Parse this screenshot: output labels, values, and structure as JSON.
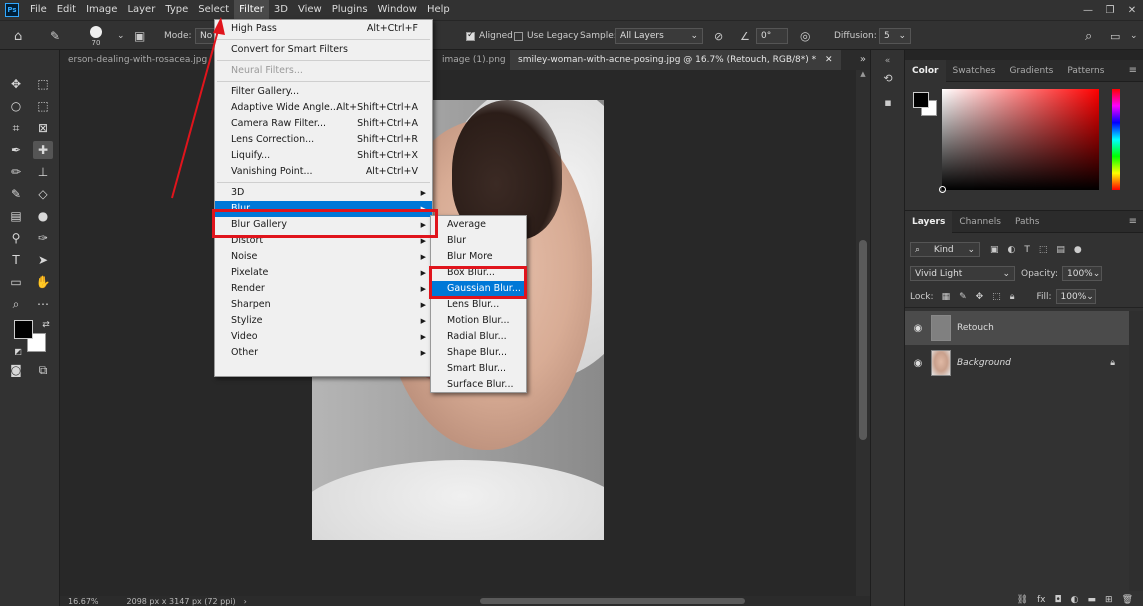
{
  "menubar": {
    "logo": "Ps",
    "items": [
      "File",
      "Edit",
      "Image",
      "Layer",
      "Type",
      "Select",
      "Filter",
      "3D",
      "View",
      "Plugins",
      "Window",
      "Help"
    ],
    "active": "Filter",
    "window_controls": [
      "—",
      "❐",
      "✕"
    ]
  },
  "options": {
    "brush_size": "70",
    "mode_label": "Mode:",
    "mode_value": "No",
    "aligned_label": "Aligned",
    "use_legacy_label": "Use Legacy",
    "sample_label": "Sample:",
    "sample_value": "All Layers",
    "angle_value": "0°",
    "diffusion_label": "Diffusion:",
    "diffusion_value": "5"
  },
  "tabs": [
    {
      "label": "erson-dealing-with-rosacea.jpg",
      "active": false
    },
    {
      "label": "image (1).png",
      "active": false
    },
    {
      "label": "smiley-woman-with-acne-posing.jpg @ 16.7% (Retouch, RGB/8*) *",
      "active": true
    }
  ],
  "status": {
    "zoom": "16.67%",
    "dimensions": "2098 px x 3147 px (72 ppi)"
  },
  "filter_menu": [
    {
      "label": "High Pass",
      "shortcut": "Alt+Ctrl+F"
    },
    {
      "sep": true
    },
    {
      "label": "Convert for Smart Filters"
    },
    {
      "sep": true
    },
    {
      "label": "Neural Filters...",
      "disabled": true
    },
    {
      "sep": true
    },
    {
      "label": "Filter Gallery..."
    },
    {
      "label": "Adaptive Wide Angle...",
      "shortcut": "Alt+Shift+Ctrl+A"
    },
    {
      "label": "Camera Raw Filter...",
      "shortcut": "Shift+Ctrl+A"
    },
    {
      "label": "Lens Correction...",
      "shortcut": "Shift+Ctrl+R"
    },
    {
      "label": "Liquify...",
      "shortcut": "Shift+Ctrl+X"
    },
    {
      "label": "Vanishing Point...",
      "shortcut": "Alt+Ctrl+V"
    },
    {
      "sep": true
    },
    {
      "label": "3D",
      "submenu": true
    },
    {
      "label": "Blur",
      "submenu": true,
      "highlighted": true
    },
    {
      "label": "Blur Gallery",
      "submenu": true
    },
    {
      "label": "Distort",
      "submenu": true
    },
    {
      "label": "Noise",
      "submenu": true
    },
    {
      "label": "Pixelate",
      "submenu": true
    },
    {
      "label": "Render",
      "submenu": true
    },
    {
      "label": "Sharpen",
      "submenu": true
    },
    {
      "label": "Stylize",
      "submenu": true
    },
    {
      "label": "Video",
      "submenu": true
    },
    {
      "label": "Other",
      "submenu": true
    }
  ],
  "blur_menu": [
    {
      "label": "Average"
    },
    {
      "label": "Blur"
    },
    {
      "label": "Blur More"
    },
    {
      "label": "Box Blur..."
    },
    {
      "label": "Gaussian Blur...",
      "highlighted": true
    },
    {
      "label": "Lens Blur..."
    },
    {
      "label": "Motion Blur..."
    },
    {
      "label": "Radial Blur..."
    },
    {
      "label": "Shape Blur..."
    },
    {
      "label": "Smart Blur..."
    },
    {
      "label": "Surface Blur..."
    }
  ],
  "color_panel": {
    "tabs": [
      "Color",
      "Swatches",
      "Gradients",
      "Patterns"
    ],
    "active": "Color"
  },
  "layers_panel": {
    "tabs": [
      "Layers",
      "Channels",
      "Paths"
    ],
    "active": "Layers",
    "filter_kind": "Kind",
    "blend_mode": "Vivid Light",
    "opacity_label": "Opacity:",
    "opacity_value": "100%",
    "lock_label": "Lock:",
    "fill_label": "Fill:",
    "fill_value": "100%",
    "layers": [
      {
        "name": "Retouch",
        "selected": true,
        "italic": false,
        "locked": false
      },
      {
        "name": "Background",
        "selected": false,
        "italic": true,
        "locked": true
      }
    ]
  },
  "colors": {
    "highlight": "#0078d7",
    "annotation": "#e0141c"
  }
}
